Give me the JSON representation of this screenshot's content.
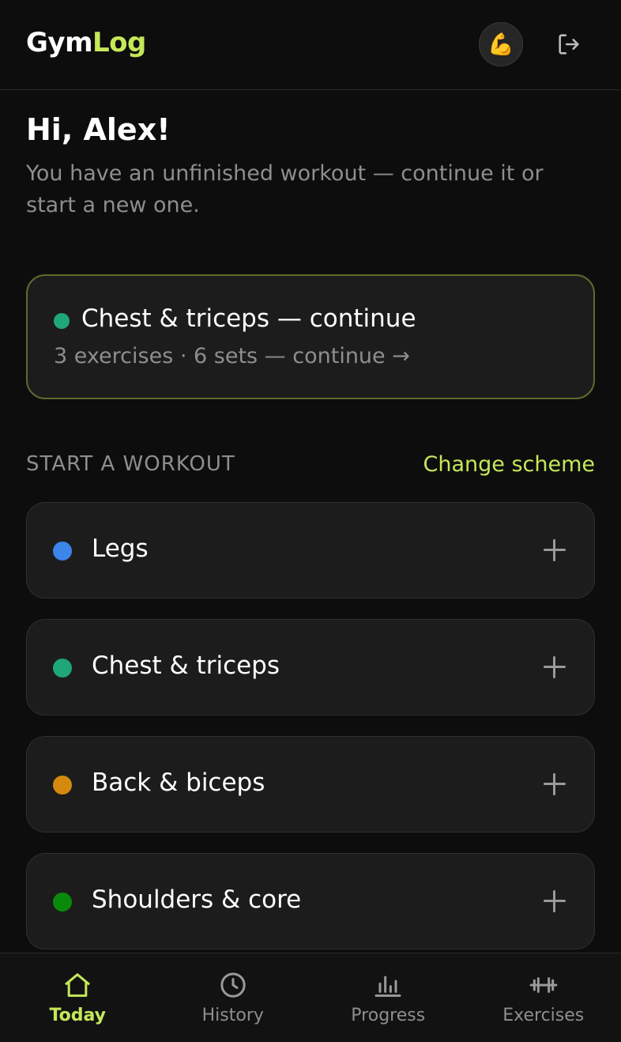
{
  "header": {
    "logo_part1": "Gym",
    "logo_part2": "Log",
    "avatar_emoji": "💪",
    "avatar_icon": "flexed-biceps",
    "logout_icon": "logout-icon"
  },
  "greeting": {
    "title": "Hi, Alex!",
    "subtitle": "You have an unfinished workout — continue it or start a new one."
  },
  "continue_card": {
    "title": "Chest & triceps — continue",
    "meta": "3 exercises · 6 sets — continue →",
    "dot_color": "#1fa67a"
  },
  "section": {
    "label": "START A WORKOUT",
    "action": "Change scheme"
  },
  "workouts": [
    {
      "name": "Legs",
      "dot_color": "#3b86e8"
    },
    {
      "name": "Chest & triceps",
      "dot_color": "#1fa67a"
    },
    {
      "name": "Back & biceps",
      "dot_color": "#d48a0f"
    },
    {
      "name": "Shoulders & core",
      "dot_color": "#0a8a0a"
    }
  ],
  "nav": [
    {
      "label": "Today",
      "icon": "home-icon",
      "active": true
    },
    {
      "label": "History",
      "icon": "clock-icon",
      "active": false
    },
    {
      "label": "Progress",
      "icon": "bar-chart-icon",
      "active": false
    },
    {
      "label": "Exercises",
      "icon": "dumbbell-icon",
      "active": false
    }
  ],
  "colors": {
    "accent": "#c5e85a",
    "background": "#0d0d0d",
    "card": "#1c1c1c",
    "muted_text": "#8e8e8e"
  }
}
